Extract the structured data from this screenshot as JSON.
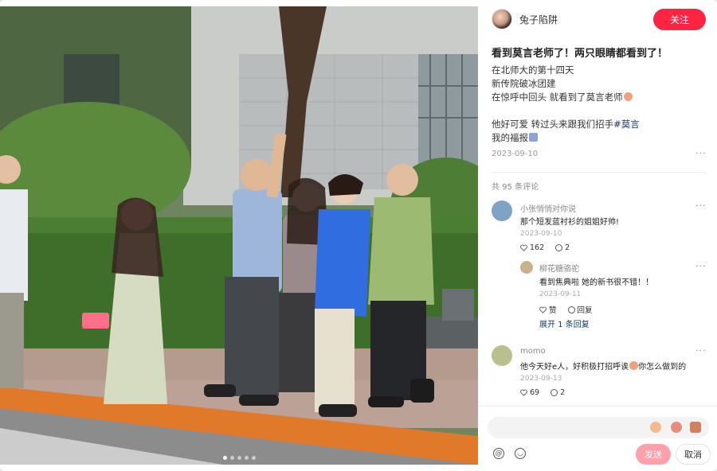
{
  "author": {
    "name": "兔子陷阱",
    "follow_label": "关注"
  },
  "post": {
    "title": "看到莫言老师了！两只眼睛都看到了！",
    "lines": [
      "在北师大的第十四天",
      "新传院破冰团建",
      "在惊呼中回头 就看到了莫言老师",
      "",
      "他好可爱 转过头来跟我们招手",
      "我的福报"
    ],
    "hashtag": "#莫言",
    "date": "2023-09-10",
    "more": "···"
  },
  "comments": {
    "count_label": "共 95 条评论",
    "items": [
      {
        "user": "小张悄悄对你说",
        "text": "那个短发蓝衬衫的姐姐好帅!",
        "date": "2023-09-10",
        "likes": "162",
        "replies": "2",
        "avatar_color": "#7fa3c7"
      },
      {
        "user": "柳花糖骆驼",
        "text": "看到焦典啦 她的新书很不错！！",
        "date": "2023-09-11",
        "likes": "赞",
        "replies": "回复",
        "avatar_color": "#c9b38a"
      },
      {
        "user": "momo",
        "text": "他今天好e人，好积极打招呼诶",
        "text_tail": "你怎么做到的",
        "date": "2023-09-13",
        "likes": "69",
        "replies": "2",
        "avatar_color": "#b9c08e"
      }
    ],
    "expand_label": "展开 1 条回复"
  },
  "composer": {
    "placeholder": "",
    "send_label": "发送",
    "cancel_label": "取消"
  },
  "colors": {
    "brand": "#ff2442",
    "send_disabled": "#ffa0ab",
    "hashtag": "#13386c"
  },
  "icons": {
    "at": "at-icon",
    "emoji": "emoji-icon",
    "like": "heart-icon",
    "reply": "comment-icon"
  }
}
